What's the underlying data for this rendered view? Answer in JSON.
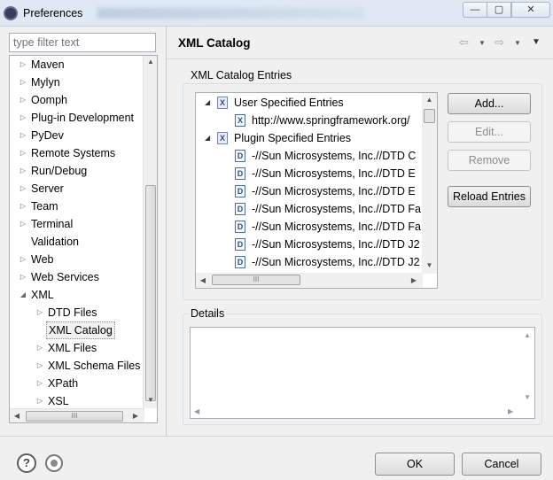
{
  "window": {
    "title": "Preferences",
    "min_icon": "minimize-icon",
    "max_icon": "maximize-icon",
    "close_icon": "close-icon"
  },
  "filter": {
    "placeholder": "type filter text"
  },
  "tree": {
    "items": [
      {
        "label": "Maven",
        "expander": "collapsed"
      },
      {
        "label": "Mylyn",
        "expander": "collapsed"
      },
      {
        "label": "Oomph",
        "expander": "collapsed"
      },
      {
        "label": "Plug-in Development",
        "expander": "collapsed"
      },
      {
        "label": "PyDev",
        "expander": "collapsed"
      },
      {
        "label": "Remote Systems",
        "expander": "collapsed"
      },
      {
        "label": "Run/Debug",
        "expander": "collapsed"
      },
      {
        "label": "Server",
        "expander": "collapsed"
      },
      {
        "label": "Team",
        "expander": "collapsed"
      },
      {
        "label": "Terminal",
        "expander": "collapsed"
      },
      {
        "label": "Validation",
        "expander": "none"
      },
      {
        "label": "Web",
        "expander": "collapsed"
      },
      {
        "label": "Web Services",
        "expander": "collapsed"
      },
      {
        "label": "XML",
        "expander": "expanded"
      },
      {
        "label": "DTD Files",
        "expander": "collapsed"
      },
      {
        "label": "XML Catalog",
        "expander": "none",
        "selected": true
      },
      {
        "label": "XML Files",
        "expander": "collapsed"
      },
      {
        "label": "XML Schema Files",
        "expander": "collapsed"
      },
      {
        "label": "XPath",
        "expander": "collapsed"
      },
      {
        "label": "XSL",
        "expander": "collapsed"
      }
    ]
  },
  "page": {
    "title": "XML Catalog"
  },
  "catalog": {
    "group_label": "XML Catalog Entries",
    "entries": [
      {
        "label": "User Specified Entries",
        "icon": "X",
        "kind": "folder"
      },
      {
        "label": "http://www.springframework.org/",
        "icon": "X",
        "kind": "entry"
      },
      {
        "label": "Plugin Specified Entries",
        "icon": "X",
        "kind": "folder"
      },
      {
        "label": "-//Sun Microsystems, Inc.//DTD C",
        "icon": "D",
        "kind": "entry"
      },
      {
        "label": "-//Sun Microsystems, Inc.//DTD E",
        "icon": "D",
        "kind": "entry"
      },
      {
        "label": "-//Sun Microsystems, Inc.//DTD E",
        "icon": "D",
        "kind": "entry"
      },
      {
        "label": "-//Sun Microsystems, Inc.//DTD Fa",
        "icon": "D",
        "kind": "entry"
      },
      {
        "label": "-//Sun Microsystems, Inc.//DTD Fa",
        "icon": "D",
        "kind": "entry"
      },
      {
        "label": "-//Sun Microsystems, Inc.//DTD J2",
        "icon": "D",
        "kind": "entry"
      },
      {
        "label": "-//Sun Microsystems, Inc.//DTD J2",
        "icon": "D",
        "kind": "entry"
      }
    ],
    "buttons": {
      "add": "Add...",
      "edit": "Edit...",
      "remove": "Remove",
      "reload": "Reload Entries"
    }
  },
  "details": {
    "group_label": "Details"
  },
  "footer": {
    "ok": "OK",
    "cancel": "Cancel",
    "help_glyph": "?"
  }
}
